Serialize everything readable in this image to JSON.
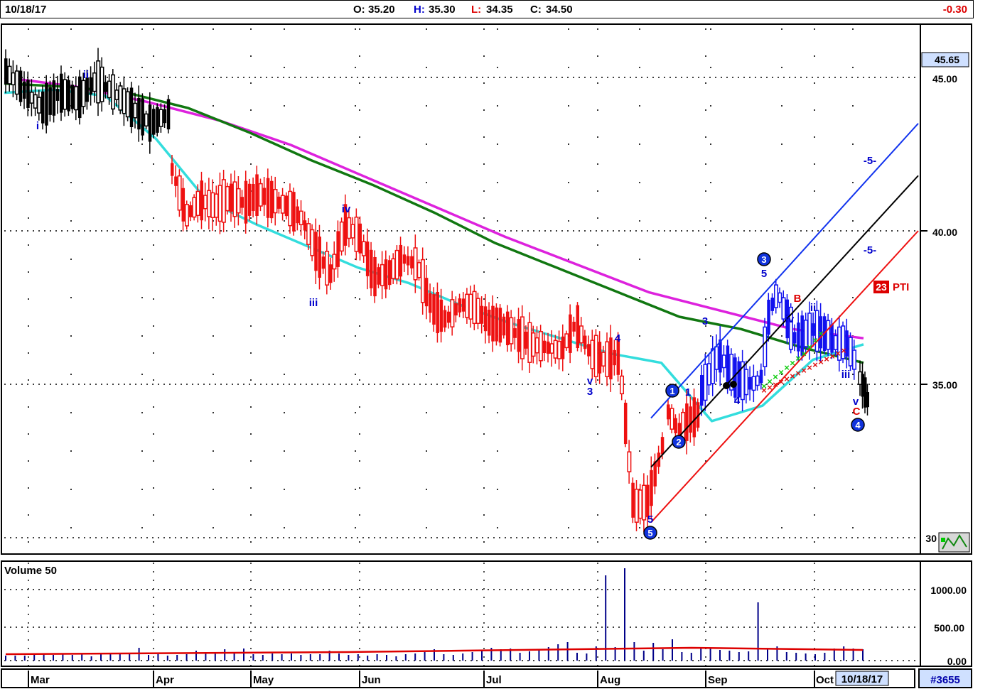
{
  "header": {
    "date": "10/18/17",
    "open_label": "O:",
    "open": "35.20",
    "high_label": "H:",
    "high": "35.30",
    "low_label": "L:",
    "low": "34.35",
    "close_label": "C:",
    "close": "34.50",
    "change": "-0.30"
  },
  "price_axis": {
    "current_price": "45.65",
    "ticks": [
      "45.00",
      "40.00",
      "35.00",
      "30"
    ]
  },
  "volume_panel": {
    "title": "Volume 50",
    "ticks": [
      "1000.00",
      "500.00",
      "0.00"
    ]
  },
  "time_axis": {
    "months": [
      "Mar",
      "Apr",
      "May",
      "Jun",
      "Jul",
      "Aug",
      "Sep",
      "Oct"
    ],
    "current_date": "10/18/17"
  },
  "footer": {
    "symbol_code": "#3655"
  },
  "annotations": {
    "waves": [
      {
        "text": "ii",
        "color": "#0000cc"
      },
      {
        "text": "i",
        "color": "#0000cc"
      },
      {
        "text": "iv",
        "color": "#0000cc"
      },
      {
        "text": "iii",
        "color": "#0000cc"
      },
      {
        "text": "4",
        "color": "#0000cc"
      },
      {
        "text": "v",
        "color": "#0000cc"
      },
      {
        "text": "3",
        "color": "#0000cc"
      },
      {
        "text": "5",
        "color": "#0000cc"
      },
      {
        "text": "1",
        "color": "#0000cc"
      },
      {
        "text": "3",
        "color": "#0000cc"
      },
      {
        "text": "4",
        "color": "#0000cc"
      },
      {
        "text": "5",
        "color": "#0000cc"
      },
      {
        "text": "B",
        "color": "#dd0000"
      },
      {
        "text": "ii",
        "color": "#0000cc"
      },
      {
        "text": "iv",
        "color": "#0000cc"
      },
      {
        "text": "iii",
        "color": "#0000cc"
      },
      {
        "text": "v",
        "color": "#0000cc"
      },
      {
        "text": "C",
        "color": "#dd0000"
      },
      {
        "text": "-5-",
        "color": "#0000cc"
      },
      {
        "text": "-5-",
        "color": "#0000cc"
      }
    ],
    "circles": [
      "1",
      "2",
      "3",
      "4",
      "5"
    ],
    "pti_value": "23",
    "pti_label": "PTI"
  },
  "chart_data": {
    "type": "bar",
    "ylim": [
      30,
      46.5
    ],
    "grid": true,
    "indicator_colors": {
      "ma_fast": "#33dddd",
      "ma_mid": "#117711",
      "ma_slow": "#dd22dd",
      "down": "#ee1111",
      "neutral": "#000000",
      "up": "#1111ee",
      "volume": "#000088",
      "volume_avg": "#dd0000"
    },
    "price_segments": [
      {
        "period": "Mar-early Apr",
        "color": "neutral",
        "path": [
          45.2,
          44.6,
          44.0,
          44.5,
          44.3,
          44.9,
          44.5,
          44.0,
          43.5,
          43.8
        ]
      },
      {
        "period": "Apr-Aug",
        "color": "down",
        "path": [
          42.0,
          40.5,
          41.0,
          40.8,
          41.1,
          40.9,
          41.2,
          41.0,
          40.8,
          40.4,
          39.3,
          38.6,
          40.2,
          39.8,
          38.5,
          38.6,
          39.1,
          38.9,
          37.5,
          37.1,
          37.6,
          37.5,
          37.0,
          36.9,
          36.6,
          36.3,
          36.2,
          36.1,
          37.0,
          36.0,
          35.8,
          35.9,
          31.0,
          31.2,
          33.0
        ]
      },
      {
        "period": "late Aug",
        "color": "down",
        "path": [
          34.1,
          33.5,
          33.8,
          34.0
        ]
      },
      {
        "period": "Sep-Oct",
        "color": "up",
        "path": [
          34.8,
          35.4,
          36.0,
          35.6,
          35.2,
          35.1,
          35.0,
          35.2,
          37.4,
          38.0,
          37.2,
          36.5,
          36.6,
          36.8,
          36.7,
          36.6,
          36.3,
          36.4,
          35.8
        ]
      },
      {
        "period": "Oct last",
        "color": "neutral",
        "path": [
          35.2,
          34.5
        ]
      }
    ],
    "moving_averages": {
      "ma_fast": [
        44.5,
        44.6,
        44.4,
        43.0,
        41.0,
        40.2,
        39.5,
        38.8,
        38.3,
        37.6,
        37.0,
        36.5,
        36.0,
        35.7,
        33.8,
        34.3,
        35.8,
        36.3
      ],
      "ma_mid": [
        44.8,
        44.7,
        44.5,
        44.0,
        43.2,
        42.3,
        41.5,
        40.6,
        39.6,
        38.8,
        38.0,
        37.2,
        36.8,
        36.2,
        35.7
      ],
      "ma_slow": [
        45.0,
        44.7,
        44.2,
        43.6,
        42.8,
        41.8,
        40.8,
        39.8,
        38.9,
        38.0,
        37.4,
        36.8,
        36.5
      ]
    },
    "trend_lines": [
      {
        "name": "blue channel",
        "from": [
          33.9
        ],
        "to": [
          43.5
        ]
      },
      {
        "name": "black channel",
        "from": [
          32.3
        ],
        "to": [
          41.8
        ]
      },
      {
        "name": "red channel",
        "from": [
          30.5
        ],
        "to": [
          40.0
        ]
      }
    ],
    "volume": {
      "ylim": [
        0,
        1300
      ],
      "values": [
        70,
        70,
        70,
        90,
        90,
        80,
        90,
        80,
        90,
        60,
        90,
        90,
        100,
        90,
        180,
        80,
        90,
        70,
        80,
        90,
        140,
        100,
        120,
        160,
        120,
        170,
        90,
        80,
        100,
        90,
        100,
        80,
        90,
        90,
        140,
        100,
        80,
        90,
        70,
        90,
        80,
        60,
        90,
        100,
        120,
        160,
        90,
        80,
        100,
        120,
        150,
        180,
        160,
        170,
        110,
        130,
        150,
        190,
        230,
        260,
        110,
        100,
        200,
        1200,
        190,
        1300,
        260,
        140,
        250,
        160,
        300,
        120,
        110,
        180,
        170,
        150,
        140,
        120,
        130,
        820,
        160,
        200,
        120,
        110,
        100,
        90,
        110,
        170,
        200,
        170,
        160
      ],
      "average": [
        90,
        95,
        100,
        105,
        110,
        115,
        120,
        130,
        140,
        150,
        160,
        170,
        180,
        170,
        160,
        150
      ]
    }
  }
}
